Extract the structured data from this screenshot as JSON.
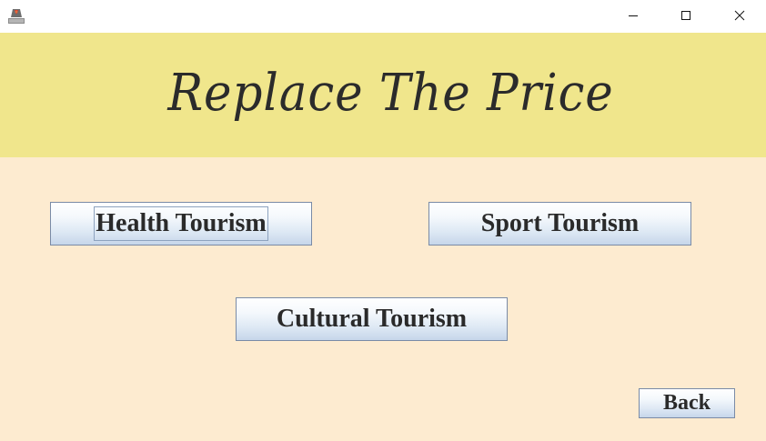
{
  "window": {
    "app_icon": "java-app-icon",
    "controls": {
      "minimize_icon": "minimize-icon",
      "maximize_icon": "maximize-icon",
      "close_icon": "close-icon"
    }
  },
  "header": {
    "title": "Replace The Price"
  },
  "buttons": {
    "health": "Health Tourism",
    "sport": "Sport Tourism",
    "cultural": "Cultural Tourism",
    "back": "Back"
  },
  "colors": {
    "header_bg": "#f0e68c",
    "content_bg": "#fdebd0",
    "button_border": "#7a8ba6",
    "text": "#2a2a2a"
  }
}
